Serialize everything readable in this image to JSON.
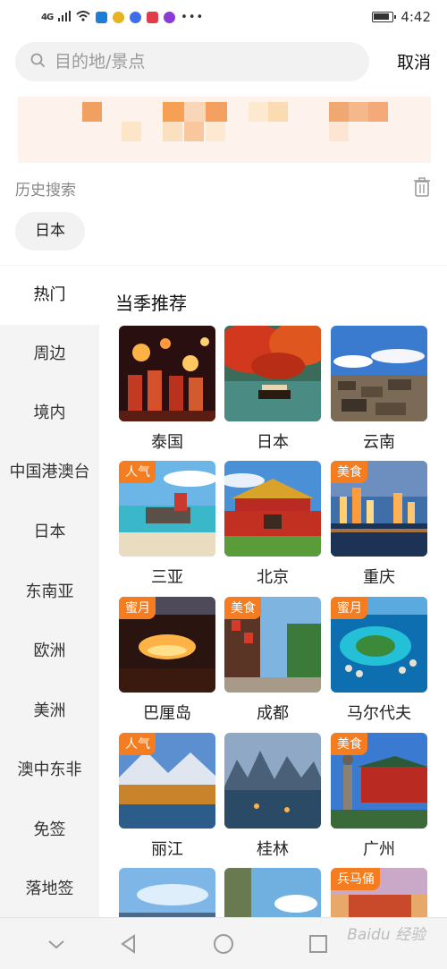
{
  "status_bar": {
    "signal": "4G",
    "time": "4:42"
  },
  "search": {
    "placeholder": "目的地/景点",
    "cancel_label": "取消"
  },
  "history": {
    "title": "历史搜索",
    "items": [
      "日本"
    ]
  },
  "sidebar": {
    "items": [
      {
        "label": "热门",
        "active": true
      },
      {
        "label": "周边"
      },
      {
        "label": "境内"
      },
      {
        "label": "中国港澳台"
      },
      {
        "label": "日本"
      },
      {
        "label": "东南亚"
      },
      {
        "label": "欧洲"
      },
      {
        "label": "美洲"
      },
      {
        "label": "澳中东非"
      },
      {
        "label": "免签"
      },
      {
        "label": "落地签"
      }
    ]
  },
  "main": {
    "section_title": "当季推荐",
    "destinations": [
      {
        "name": "泰国",
        "badge": ""
      },
      {
        "name": "日本",
        "badge": ""
      },
      {
        "name": "云南",
        "badge": ""
      },
      {
        "name": "三亚",
        "badge": "人气"
      },
      {
        "name": "北京",
        "badge": ""
      },
      {
        "name": "重庆",
        "badge": "美食"
      },
      {
        "name": "巴厘岛",
        "badge": "蜜月"
      },
      {
        "name": "成都",
        "badge": "美食"
      },
      {
        "name": "马尔代夫",
        "badge": "蜜月"
      },
      {
        "name": "丽江",
        "badge": "人气"
      },
      {
        "name": "桂林",
        "badge": ""
      },
      {
        "name": "广州",
        "badge": "美食"
      },
      {
        "name": "",
        "badge": ""
      },
      {
        "name": "",
        "badge": ""
      },
      {
        "name": "",
        "badge": "兵马俑"
      }
    ]
  },
  "colors": {
    "badge": "#f57c1f",
    "accent": "#f57c1f"
  },
  "watermark": "Baidu 经验"
}
